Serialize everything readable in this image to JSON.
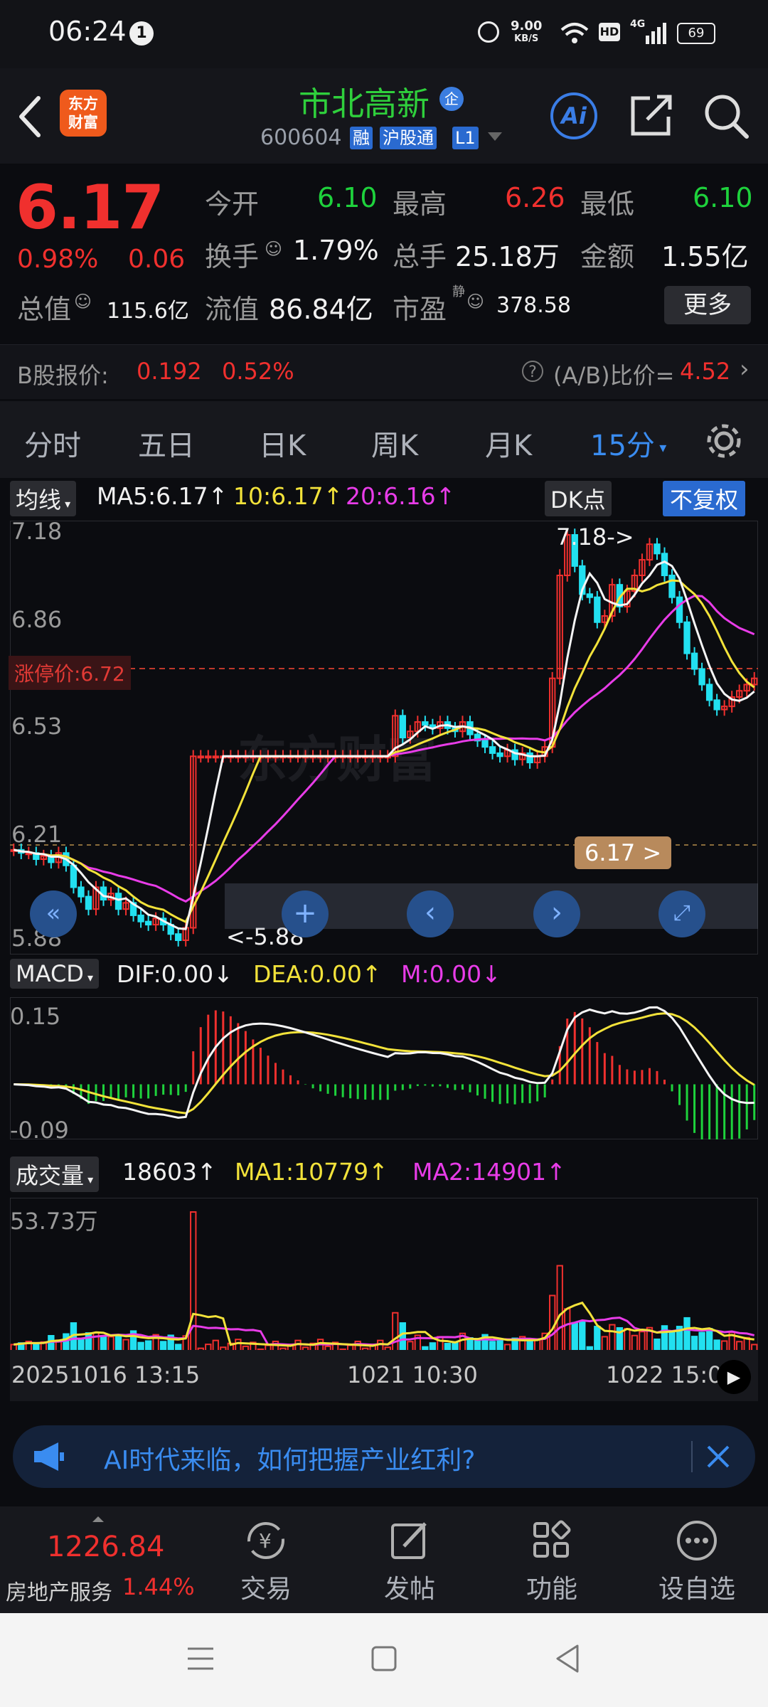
{
  "status_bar": {
    "time": "06:24",
    "notif_count": "1",
    "net_speed": "9.00",
    "net_unit": "KB/S",
    "hd": "HD",
    "signal": "4G",
    "battery": "69"
  },
  "header": {
    "logo": [
      "东方",
      "财富"
    ],
    "name": "市北高新",
    "corp_badge": "企",
    "code": "600604",
    "tags": [
      "融",
      "沪股通",
      "L1"
    ]
  },
  "quote": {
    "price": "6.17",
    "change_pct": "0.98%",
    "change": "0.06",
    "open_label": "今开",
    "open": "6.10",
    "high_label": "最高",
    "high": "6.26",
    "low_label": "最低",
    "low": "6.10",
    "turnover_label": "换手",
    "turnover": "1.79%",
    "volume_label": "总手",
    "volume": "25.18万",
    "amount_label": "金额",
    "amount": "1.55亿",
    "mcap_label": "总值",
    "mcap": "115.6亿",
    "float_label": "流值",
    "float": "86.84亿",
    "pe_label": "市盈",
    "pe_sup": "静",
    "pe": "378.58",
    "more": "更多"
  },
  "b_quote": {
    "label": "B股报价:",
    "price": "0.192",
    "pct": "0.52%",
    "ratio_label": "(A/B)比价=",
    "ratio": "4.52"
  },
  "tabs": [
    "分时",
    "五日",
    "日K",
    "周K",
    "月K",
    "15分"
  ],
  "ma_legend": {
    "button": "均线",
    "ma5": "MA5:6.17",
    "ma10": "10:6.17",
    "ma20": "20:6.16",
    "dk": "DK点",
    "fq": "不复权"
  },
  "price_axis": [
    "7.18",
    "6.86",
    "6.53",
    "6.21",
    "5.88"
  ],
  "limit_up": "涨停价:6.72",
  "current_tag": "6.17 >",
  "max_label": "7.18->",
  "min_label": "<-5.88",
  "macd_legend": {
    "button": "MACD",
    "dif": "DIF:0.00",
    "dea": "DEA:0.00",
    "m": "M:0.00"
  },
  "macd_axis": [
    "0.15",
    "-0.09"
  ],
  "vol_legend": {
    "button": "成交量",
    "vol": "18603",
    "ma1": "MA1:10779",
    "ma2": "MA2:14901"
  },
  "vol_axis": "53.73万",
  "time_axis": [
    "20251016 13:15",
    "1021 10:30",
    "1022 15:0"
  ],
  "watermark": "东方财富",
  "banner": "AI时代来临，如何把握产业红利?",
  "bottom": {
    "index_value": "1226.84",
    "index_name": "房地产服务",
    "index_pct": "1.44%",
    "items": [
      "交易",
      "发帖",
      "功能",
      "设自选"
    ]
  },
  "chart_data": {
    "type": "candlestick",
    "y_range": [
      5.88,
      7.18
    ],
    "limit_up": 6.72,
    "last_price": 6.17,
    "closes": [
      6.17,
      6.16,
      6.16,
      6.14,
      6.15,
      6.13,
      6.16,
      6.12,
      6.05,
      6.02,
      5.98,
      6.05,
      6.01,
      6.03,
      5.98,
      6.0,
      5.96,
      5.94,
      5.93,
      5.95,
      5.93,
      5.9,
      5.88,
      5.92,
      6.47,
      6.47,
      6.47,
      6.47,
      6.47,
      6.47,
      6.47,
      6.47,
      6.47,
      6.47,
      6.47,
      6.47,
      6.47,
      6.47,
      6.47,
      6.47,
      6.47,
      6.47,
      6.47,
      6.47,
      6.47,
      6.47,
      6.47,
      6.47,
      6.47,
      6.47,
      6.47,
      6.6,
      6.53,
      6.55,
      6.58,
      6.57,
      6.56,
      6.58,
      6.56,
      6.55,
      6.58,
      6.54,
      6.52,
      6.5,
      6.48,
      6.47,
      6.49,
      6.46,
      6.48,
      6.45,
      6.47,
      6.5,
      6.72,
      7.05,
      7.18,
      7.08,
      6.99,
      6.98,
      6.9,
      6.92,
      7.02,
      6.95,
      7.0,
      7.05,
      7.1,
      7.15,
      7.12,
      7.05,
      6.98,
      6.9,
      6.8,
      6.75,
      6.7,
      6.65,
      6.62,
      6.63,
      6.66,
      6.68,
      6.7,
      6.72
    ],
    "macd_range": [
      -0.09,
      0.15
    ],
    "volume_max": "53.73万"
  }
}
